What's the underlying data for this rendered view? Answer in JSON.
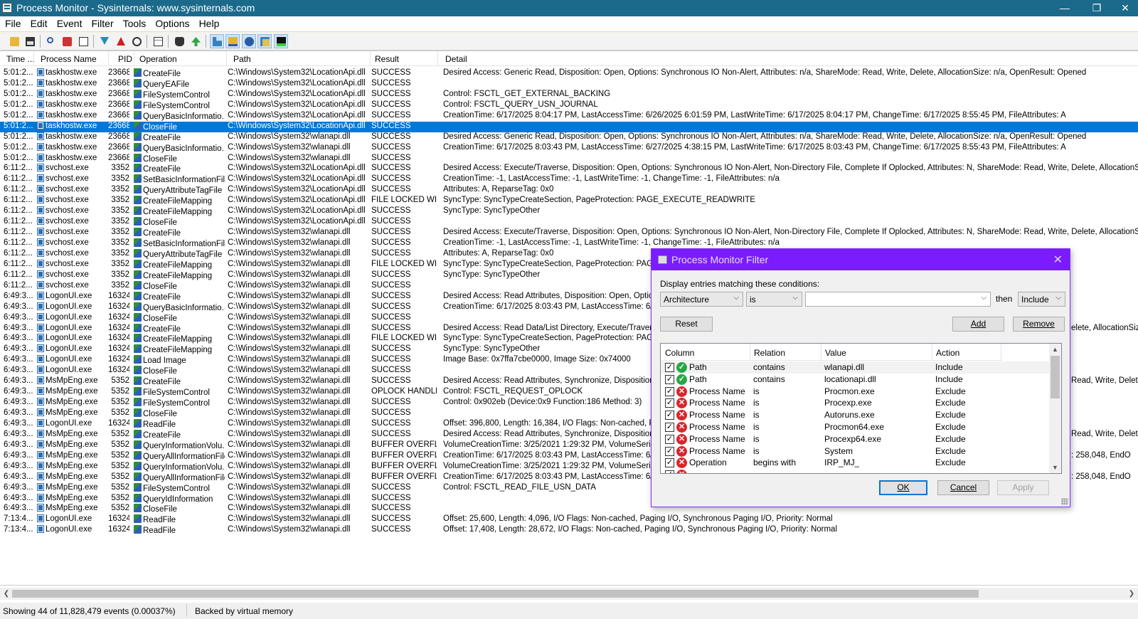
{
  "window": {
    "title": "Process Monitor - Sysinternals: www.sysinternals.com"
  },
  "menu": [
    "File",
    "Edit",
    "Event",
    "Filter",
    "Tools",
    "Options",
    "Help"
  ],
  "toolbar": [
    "open-icon",
    "save-icon",
    "find-icon",
    "capture-icon",
    "autoscroll-icon",
    "filter-icon",
    "highlight-icon",
    "target-icon",
    "properties-icon",
    "jump-icon",
    "find-next-icon",
    "registry-activity-icon",
    "file-activity-icon",
    "network-activity-icon",
    "process-activity-icon",
    "profiling-icon"
  ],
  "columns": [
    "Time ...",
    "Process Name",
    "PID",
    "Operation",
    "Path",
    "Result",
    "Detail"
  ],
  "events": [
    {
      "time": "5:01:2...",
      "proc": "taskhostw.exe",
      "pid": "23668",
      "op": "CreateFile",
      "path": "C:\\Windows\\System32\\LocationApi.dll",
      "result": "SUCCESS",
      "detail": "Desired Access: Generic Read, Disposition: Open, Options: Synchronous IO Non-Alert, Attributes: n/a, ShareMode: Read, Write, Delete, AllocationSize: n/a, OpenResult: Opened"
    },
    {
      "time": "5:01:2...",
      "proc": "taskhostw.exe",
      "pid": "23668",
      "op": "QueryEAFile",
      "path": "C:\\Windows\\System32\\LocationApi.dll",
      "result": "SUCCESS",
      "detail": ""
    },
    {
      "time": "5:01:2...",
      "proc": "taskhostw.exe",
      "pid": "23668",
      "op": "FileSystemControl",
      "path": "C:\\Windows\\System32\\LocationApi.dll",
      "result": "SUCCESS",
      "detail": "Control: FSCTL_GET_EXTERNAL_BACKING"
    },
    {
      "time": "5:01:2...",
      "proc": "taskhostw.exe",
      "pid": "23668",
      "op": "FileSystemControl",
      "path": "C:\\Windows\\System32\\LocationApi.dll",
      "result": "SUCCESS",
      "detail": "Control: FSCTL_QUERY_USN_JOURNAL"
    },
    {
      "time": "5:01:2...",
      "proc": "taskhostw.exe",
      "pid": "23668",
      "op": "QueryBasicInformatio...",
      "path": "C:\\Windows\\System32\\LocationApi.dll",
      "result": "SUCCESS",
      "detail": "CreationTime: 6/17/2025 8:04:17 PM, LastAccessTime: 6/26/2025 6:01:59 PM, LastWriteTime: 6/17/2025 8:04:17 PM, ChangeTime: 6/17/2025 8:55:45 PM, FileAttributes: A"
    },
    {
      "time": "5:01:2...",
      "proc": "taskhostw.exe",
      "pid": "23668",
      "op": "CloseFile",
      "path": "C:\\Windows\\System32\\LocationApi.dll",
      "result": "SUCCESS",
      "detail": "",
      "selected": true
    },
    {
      "time": "5:01:2...",
      "proc": "taskhostw.exe",
      "pid": "23668",
      "op": "CreateFile",
      "path": "C:\\Windows\\System32\\wlanapi.dll",
      "result": "SUCCESS",
      "detail": "Desired Access: Generic Read, Disposition: Open, Options: Synchronous IO Non-Alert, Attributes: n/a, ShareMode: Read, Write, Delete, AllocationSize: n/a, OpenResult: Opened"
    },
    {
      "time": "5:01:2...",
      "proc": "taskhostw.exe",
      "pid": "23668",
      "op": "QueryBasicInformatio...",
      "path": "C:\\Windows\\System32\\wlanapi.dll",
      "result": "SUCCESS",
      "detail": "CreationTime: 6/17/2025 8:03:43 PM, LastAccessTime: 6/27/2025 4:38:15 PM, LastWriteTime: 6/17/2025 8:03:43 PM, ChangeTime: 6/17/2025 8:55:43 PM, FileAttributes: A"
    },
    {
      "time": "5:01:2...",
      "proc": "taskhostw.exe",
      "pid": "23668",
      "op": "CloseFile",
      "path": "C:\\Windows\\System32\\wlanapi.dll",
      "result": "SUCCESS",
      "detail": ""
    },
    {
      "time": "6:11:2...",
      "proc": "svchost.exe",
      "pid": "3352",
      "op": "CreateFile",
      "path": "C:\\Windows\\System32\\LocationApi.dll",
      "result": "SUCCESS",
      "detail": "Desired Access: Execute/Traverse, Disposition: Open, Options: Synchronous IO Non-Alert, Non-Directory File, Complete If Oplocked, Attributes: N, ShareMode: Read, Write, Delete, AllocationSize: n/a, Impers"
    },
    {
      "time": "6:11:2...",
      "proc": "svchost.exe",
      "pid": "3352",
      "op": "SetBasicInformationFile",
      "path": "C:\\Windows\\System32\\LocationApi.dll",
      "result": "SUCCESS",
      "detail": "CreationTime: -1, LastAccessTime: -1, LastWriteTime: -1, ChangeTime: -1, FileAttributes: n/a"
    },
    {
      "time": "6:11:2...",
      "proc": "svchost.exe",
      "pid": "3352",
      "op": "QueryAttributeTagFile",
      "path": "C:\\Windows\\System32\\LocationApi.dll",
      "result": "SUCCESS",
      "detail": "Attributes: A, ReparseTag: 0x0"
    },
    {
      "time": "6:11:2...",
      "proc": "svchost.exe",
      "pid": "3352",
      "op": "CreateFileMapping",
      "path": "C:\\Windows\\System32\\LocationApi.dll",
      "result": "FILE LOCKED WI...",
      "detail": "SyncType: SyncTypeCreateSection, PageProtection: PAGE_EXECUTE_READWRITE"
    },
    {
      "time": "6:11:2...",
      "proc": "svchost.exe",
      "pid": "3352",
      "op": "CreateFileMapping",
      "path": "C:\\Windows\\System32\\LocationApi.dll",
      "result": "SUCCESS",
      "detail": "SyncType: SyncTypeOther"
    },
    {
      "time": "6:11:2...",
      "proc": "svchost.exe",
      "pid": "3352",
      "op": "CloseFile",
      "path": "C:\\Windows\\System32\\LocationApi.dll",
      "result": "SUCCESS",
      "detail": ""
    },
    {
      "time": "6:11:2...",
      "proc": "svchost.exe",
      "pid": "3352",
      "op": "CreateFile",
      "path": "C:\\Windows\\System32\\wlanapi.dll",
      "result": "SUCCESS",
      "detail": "Desired Access: Execute/Traverse, Disposition: Open, Options: Synchronous IO Non-Alert, Non-Directory File, Complete If Oplocked, Attributes: N, ShareMode: Read, Write, Delete, AllocationSize: n/a, Impers"
    },
    {
      "time": "6:11:2...",
      "proc": "svchost.exe",
      "pid": "3352",
      "op": "SetBasicInformationFile",
      "path": "C:\\Windows\\System32\\wlanapi.dll",
      "result": "SUCCESS",
      "detail": "CreationTime: -1, LastAccessTime: -1, LastWriteTime: -1, ChangeTime: -1, FileAttributes: n/a"
    },
    {
      "time": "6:11:2...",
      "proc": "svchost.exe",
      "pid": "3352",
      "op": "QueryAttributeTagFile",
      "path": "C:\\Windows\\System32\\wlanapi.dll",
      "result": "SUCCESS",
      "detail": "Attributes: A, ReparseTag: 0x0"
    },
    {
      "time": "6:11:2...",
      "proc": "svchost.exe",
      "pid": "3352",
      "op": "CreateFileMapping",
      "path": "C:\\Windows\\System32\\wlanapi.dll",
      "result": "FILE LOCKED WI...",
      "detail": "SyncType: SyncTypeCreateSection, PageProtection: PAGE_E"
    },
    {
      "time": "6:11:2...",
      "proc": "svchost.exe",
      "pid": "3352",
      "op": "CreateFileMapping",
      "path": "C:\\Windows\\System32\\wlanapi.dll",
      "result": "SUCCESS",
      "detail": "SyncType: SyncTypeOther"
    },
    {
      "time": "6:11:2...",
      "proc": "svchost.exe",
      "pid": "3352",
      "op": "CloseFile",
      "path": "C:\\Windows\\System32\\wlanapi.dll",
      "result": "SUCCESS",
      "detail": ""
    },
    {
      "time": "6:49:3...",
      "proc": "LogonUI.exe",
      "pid": "16324",
      "op": "CreateFile",
      "path": "C:\\Windows\\System32\\wlanapi.dll",
      "result": "SUCCESS",
      "detail": "Desired Access: Read Attributes, Disposition: Open, Options: C"
    },
    {
      "time": "6:49:3...",
      "proc": "LogonUI.exe",
      "pid": "16324",
      "op": "QueryBasicInformatio...",
      "path": "C:\\Windows\\System32\\wlanapi.dll",
      "result": "SUCCESS",
      "detail": "CreationTime: 6/17/2025 8:03:43 PM, LastAccessTime: 6/27/"
    },
    {
      "time": "6:49:3...",
      "proc": "LogonUI.exe",
      "pid": "16324",
      "op": "CloseFile",
      "path": "C:\\Windows\\System32\\wlanapi.dll",
      "result": "SUCCESS",
      "detail": ""
    },
    {
      "time": "6:49:3...",
      "proc": "LogonUI.exe",
      "pid": "16324",
      "op": "CreateFile",
      "path": "C:\\Windows\\System32\\wlanapi.dll",
      "result": "SUCCESS",
      "detail": "Desired Access: Read Data/List Directory, Execute/Traverse,",
      "tail": "elete, AllocationSiz"
    },
    {
      "time": "6:49:3...",
      "proc": "LogonUI.exe",
      "pid": "16324",
      "op": "CreateFileMapping",
      "path": "C:\\Windows\\System32\\wlanapi.dll",
      "result": "FILE LOCKED WI...",
      "detail": "SyncType: SyncTypeCreateSection, PageProtection: PAGE_E"
    },
    {
      "time": "6:49:3...",
      "proc": "LogonUI.exe",
      "pid": "16324",
      "op": "CreateFileMapping",
      "path": "C:\\Windows\\System32\\wlanapi.dll",
      "result": "SUCCESS",
      "detail": "SyncType: SyncTypeOther"
    },
    {
      "time": "6:49:3...",
      "proc": "LogonUI.exe",
      "pid": "16324",
      "op": "Load Image",
      "path": "C:\\Windows\\System32\\wlanapi.dll",
      "result": "SUCCESS",
      "detail": "Image Base: 0x7ffa7cbe0000, Image Size: 0x74000"
    },
    {
      "time": "6:49:3...",
      "proc": "LogonUI.exe",
      "pid": "16324",
      "op": "CloseFile",
      "path": "C:\\Windows\\System32\\wlanapi.dll",
      "result": "SUCCESS",
      "detail": ""
    },
    {
      "time": "6:49:3...",
      "proc": "MsMpEng.exe",
      "pid": "5352",
      "op": "CreateFile",
      "path": "C:\\Windows\\System32\\wlanapi.dll",
      "result": "SUCCESS",
      "detail": "Desired Access: Read Attributes, Synchronize, Disposition: Ope",
      "tail": "Read, Write, Delete"
    },
    {
      "time": "6:49:3...",
      "proc": "MsMpEng.exe",
      "pid": "5352",
      "op": "FileSystemControl",
      "path": "C:\\Windows\\System32\\wlanapi.dll",
      "result": "OPLOCK HANDLE...",
      "detail": "Control: FSCTL_REQUEST_OPLOCK"
    },
    {
      "time": "6:49:3...",
      "proc": "MsMpEng.exe",
      "pid": "5352",
      "op": "FileSystemControl",
      "path": "C:\\Windows\\System32\\wlanapi.dll",
      "result": "SUCCESS",
      "detail": "Control: 0x902eb (Device:0x9 Function:186 Method: 3)"
    },
    {
      "time": "6:49:3...",
      "proc": "MsMpEng.exe",
      "pid": "5352",
      "op": "CloseFile",
      "path": "C:\\Windows\\System32\\wlanapi.dll",
      "result": "SUCCESS",
      "detail": ""
    },
    {
      "time": "6:49:3...",
      "proc": "LogonUI.exe",
      "pid": "16324",
      "op": "ReadFile",
      "path": "C:\\Windows\\System32\\wlanapi.dll",
      "result": "SUCCESS",
      "detail": "Offset: 396,800, Length: 16,384, I/O Flags: Non-cached, Pagir"
    },
    {
      "time": "6:49:3...",
      "proc": "MsMpEng.exe",
      "pid": "5352",
      "op": "CreateFile",
      "path": "C:\\Windows\\System32\\wlanapi.dll",
      "result": "SUCCESS",
      "detail": "Desired Access: Read Attributes, Synchronize, Disposition: Ope",
      "tail": "Read, Write, Delete,"
    },
    {
      "time": "6:49:3...",
      "proc": "MsMpEng.exe",
      "pid": "5352",
      "op": "QueryInformationVolu...",
      "path": "C:\\Windows\\System32\\wlanapi.dll",
      "result": "BUFFER OVERFL...",
      "detail": "VolumeCreationTime: 3/25/2021 1:29:32 PM, VolumeSerialNur"
    },
    {
      "time": "6:49:3...",
      "proc": "MsMpEng.exe",
      "pid": "5352",
      "op": "QueryAllInformationFile",
      "path": "C:\\Windows\\System32\\wlanapi.dll",
      "result": "BUFFER OVERFL...",
      "detail": "CreationTime: 6/17/2025 8:03:43 PM, LastAccessTime: 6/27/",
      "tail": ": 258,048, EndO"
    },
    {
      "time": "6:49:3...",
      "proc": "MsMpEng.exe",
      "pid": "5352",
      "op": "QueryInformationVolu...",
      "path": "C:\\Windows\\System32\\wlanapi.dll",
      "result": "BUFFER OVERFL...",
      "detail": "VolumeCreationTime: 3/25/2021 1:29:32 PM, VolumeSerialNur"
    },
    {
      "time": "6:49:3...",
      "proc": "MsMpEng.exe",
      "pid": "5352",
      "op": "QueryAllInformationFile",
      "path": "C:\\Windows\\System32\\wlanapi.dll",
      "result": "BUFFER OVERFL...",
      "detail": "CreationTime: 6/17/2025 8:03:43 PM, LastAccessTime: 6/27/",
      "tail": ": 258,048, EndO"
    },
    {
      "time": "6:49:3...",
      "proc": "MsMpEng.exe",
      "pid": "5352",
      "op": "FileSystemControl",
      "path": "C:\\Windows\\System32\\wlanapi.dll",
      "result": "SUCCESS",
      "detail": "Control: FSCTL_READ_FILE_USN_DATA"
    },
    {
      "time": "6:49:3...",
      "proc": "MsMpEng.exe",
      "pid": "5352",
      "op": "QueryIdInformation",
      "path": "C:\\Windows\\System32\\wlanapi.dll",
      "result": "SUCCESS",
      "detail": ""
    },
    {
      "time": "6:49:3...",
      "proc": "MsMpEng.exe",
      "pid": "5352",
      "op": "CloseFile",
      "path": "C:\\Windows\\System32\\wlanapi.dll",
      "result": "SUCCESS",
      "detail": ""
    },
    {
      "time": "7:13:4...",
      "proc": "LogonUI.exe",
      "pid": "16324",
      "op": "ReadFile",
      "path": "C:\\Windows\\System32\\wlanapi.dll",
      "result": "SUCCESS",
      "detail": "Offset: 25,600, Length: 4,096, I/O Flags: Non-cached, Paging I/O, Synchronous Paging I/O, Priority: Normal"
    },
    {
      "time": "7:13:4...",
      "proc": "LogonUI.exe",
      "pid": "16324",
      "op": "ReadFile",
      "path": "C:\\Windows\\System32\\wlanapi.dll",
      "result": "SUCCESS",
      "detail": "Offset: 17,408, Length: 28,672, I/O Flags: Non-cached, Paging I/O, Synchronous Paging I/O, Priority: Normal"
    }
  ],
  "status": {
    "events": "Showing 44 of 11,828,479 events (0.00037%)",
    "memory": "Backed by virtual memory"
  },
  "filter_dialog": {
    "title": "Process Monitor Filter",
    "prompt": "Display entries matching these conditions:",
    "column_select": "Architecture",
    "relation_select": "is",
    "value_input": "",
    "then_label": "then",
    "action_select": "Include",
    "reset": "Reset",
    "add": "Add",
    "remove": "Remove",
    "list_headers": [
      "Column",
      "Relation",
      "Value",
      "Action"
    ],
    "rules": [
      {
        "column": "Path",
        "relation": "contains",
        "value": "wlanapi.dll",
        "action": "Include",
        "type": "include",
        "highlight": true
      },
      {
        "column": "Path",
        "relation": "contains",
        "value": "locationapi.dll",
        "action": "Include",
        "type": "include"
      },
      {
        "column": "Process Name",
        "relation": "is",
        "value": "Procmon.exe",
        "action": "Exclude",
        "type": "exclude"
      },
      {
        "column": "Process Name",
        "relation": "is",
        "value": "Procexp.exe",
        "action": "Exclude",
        "type": "exclude"
      },
      {
        "column": "Process Name",
        "relation": "is",
        "value": "Autoruns.exe",
        "action": "Exclude",
        "type": "exclude"
      },
      {
        "column": "Process Name",
        "relation": "is",
        "value": "Procmon64.exe",
        "action": "Exclude",
        "type": "exclude"
      },
      {
        "column": "Process Name",
        "relation": "is",
        "value": "Procexp64.exe",
        "action": "Exclude",
        "type": "exclude"
      },
      {
        "column": "Process Name",
        "relation": "is",
        "value": "System",
        "action": "Exclude",
        "type": "exclude"
      },
      {
        "column": "Operation",
        "relation": "begins with",
        "value": "IRP_MJ_",
        "action": "Exclude",
        "type": "exclude"
      },
      {
        "column": "",
        "relation": "",
        "value": "",
        "action": "",
        "type": "exclude"
      }
    ],
    "ok": "OK",
    "cancel": "Cancel",
    "apply": "Apply"
  }
}
